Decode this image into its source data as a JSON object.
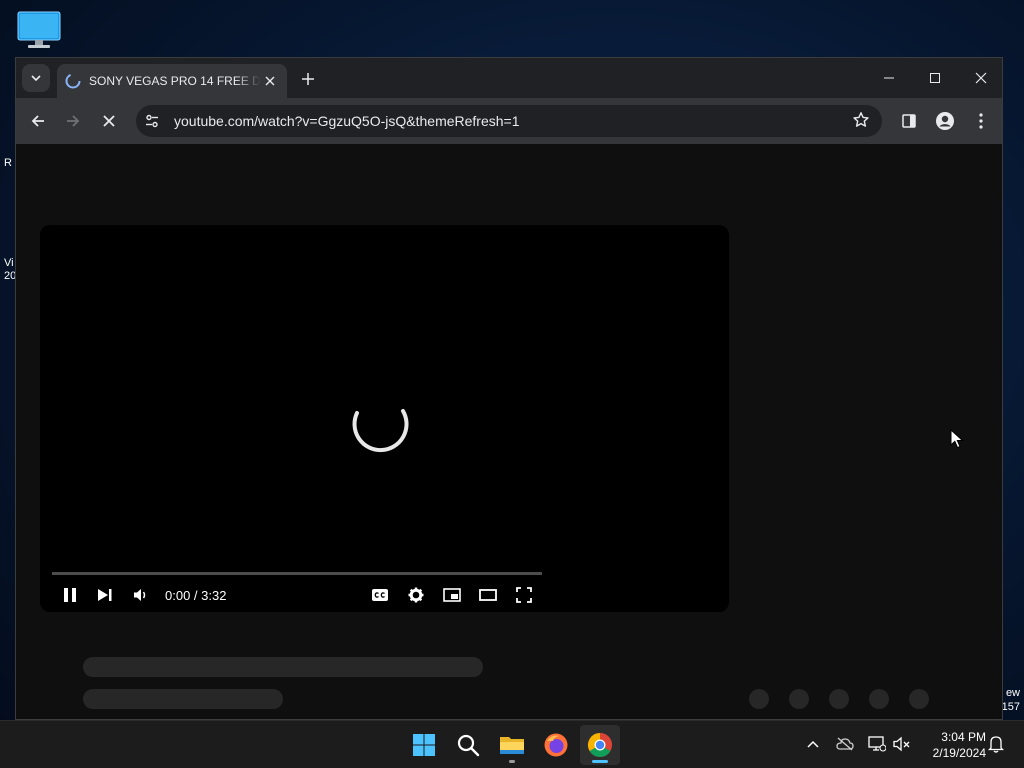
{
  "desktop": {
    "left_fragments": [
      "R",
      "Vi",
      "20"
    ],
    "right_fragments": [
      "ew",
      "157"
    ]
  },
  "browser": {
    "tab": {
      "title": "SONY VEGAS PRO 14 FREE DOWNLOAD"
    },
    "address": {
      "url": "youtube.com/watch?v=GgzuQ5O-jsQ&themeRefresh=1"
    }
  },
  "player": {
    "time_display": "0:00 / 3:32",
    "progress": 0
  },
  "taskbar": {
    "clock": {
      "time": "3:04 PM",
      "date": "2/19/2024"
    }
  },
  "colors": {
    "page_background": "#0f0f0f",
    "toolbar": "#35363a",
    "titlebar": "#202124",
    "chrome_indicator": "#4cc2ff"
  }
}
